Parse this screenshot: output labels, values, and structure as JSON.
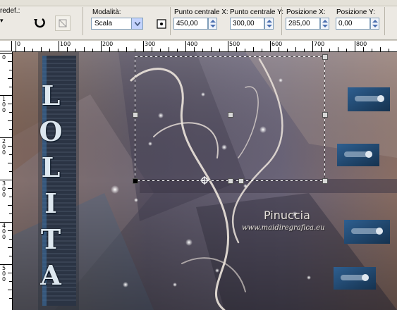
{
  "toolbar": {
    "preset_label": "redef.:",
    "mode": {
      "label": "Modalità:",
      "value": "Scala"
    },
    "center_x": {
      "label": "Punto centrale X:",
      "value": "450,00"
    },
    "center_y": {
      "label": "Punto centrale Y:",
      "value": "300,00"
    },
    "pos_x": {
      "label": "Posizione X:",
      "value": "285,00"
    },
    "pos_y": {
      "label": "Posizione Y:",
      "value": "0,00"
    }
  },
  "ruler": {
    "h_ticks": [
      "100",
      "200",
      "300",
      "400",
      "500",
      "600",
      "700",
      "800"
    ],
    "v_ticks": [
      "1\n0\n0",
      "2\n0\n0",
      "3\n0\n0",
      "4\n0\n0",
      "5\n0\n0"
    ],
    "h_zero": "0",
    "v_zero": "0"
  },
  "artwork": {
    "title_letters": [
      "L",
      "O",
      "L",
      "I",
      "T",
      "A"
    ],
    "signature": "Pinuccia",
    "website": "www.maidiregrafica.eu"
  },
  "colors": {
    "accent": "#1e4a78",
    "toolbar_bg": "#ece9e3"
  }
}
